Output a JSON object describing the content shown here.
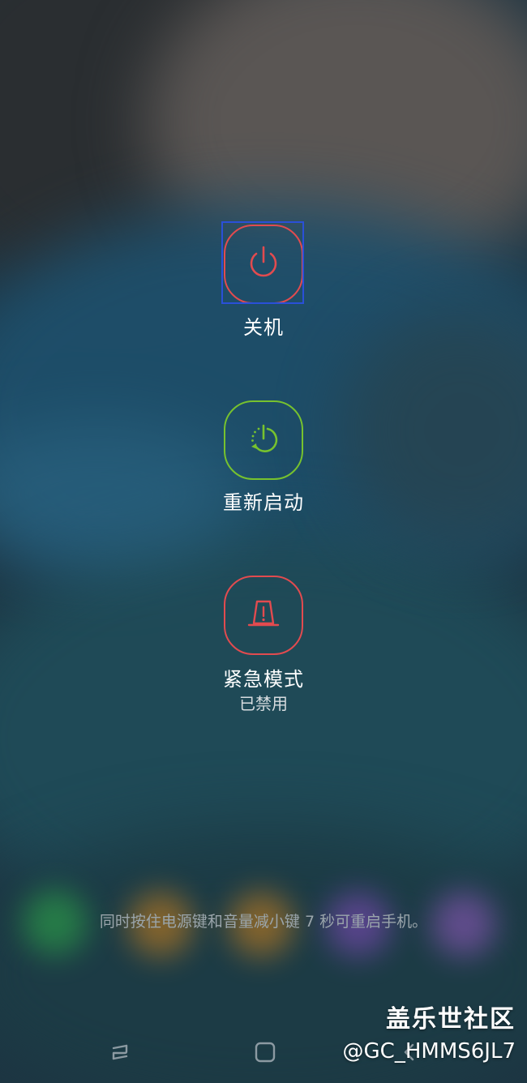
{
  "actions": {
    "power_off": {
      "label": "关机",
      "icon": "power-icon",
      "color": "#e24b4f"
    },
    "restart": {
      "label": "重新启动",
      "icon": "restart-icon",
      "color": "#77c22e"
    },
    "emergency": {
      "label": "紧急模式",
      "status": "已禁用",
      "icon": "emergency-icon",
      "color": "#e24b4f"
    }
  },
  "hint": "同时按住电源键和音量减小键 7 秒可重启手机。",
  "navbar": {
    "back_icon": "back-icon",
    "home_icon": "home-icon",
    "recent_icon": "recent-apps-icon"
  },
  "watermark": {
    "title": "盖乐世社区",
    "user": "@GC_HMMS6JL7"
  }
}
